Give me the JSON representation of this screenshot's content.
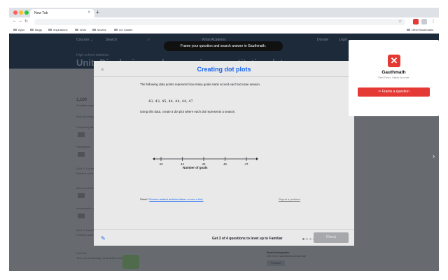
{
  "browser": {
    "tab_title": "New Tab",
    "tab_close": "×",
    "new_tab": "+",
    "bookmarks": [
      "Apps",
      "Blogs",
      "Inspirations",
      "Work",
      "Movies",
      "UX Guides"
    ],
    "other_bookmarks": "Other Bookmarks",
    "colors": {
      "close": "#ff5f57",
      "minimize": "#febc2e",
      "maximize": "#28c840"
    }
  },
  "background_page": {
    "nav": {
      "courses": "Courses ⌄",
      "search": "Search",
      "site": "Khan Academy",
      "donate": "Donate",
      "login": "Login"
    },
    "breadcrumb": "High school statistics",
    "title": "Unit: Displaying and comparing quantitative data",
    "side_items": [
      "1,100",
      "Possible mastery points",
      "Skill Summary",
      "Frequency tables & dot plots",
      "Histograms",
      "Quiz 1: 5 questions",
      "Practice what you've learned, and level up on the above skills",
      "Mean and median",
      "Interquartile range (IQR)",
      "Quiz 2: 5 questions",
      "Practice what you've learned, and level up on the above skills",
      "Unit test",
      "Test your knowledge of all skills in this unit"
    ],
    "card": {
      "title": "Read histograms",
      "subtitle": "Get 3 of 4 questions to level up!",
      "button": "Practice"
    }
  },
  "banner": "Frame your question and search answer in Gauthmath.",
  "modal": {
    "close": "×",
    "title": "Creating dot plots",
    "intro": "The following data points represent how many goals Hank scored each lacrosse season.",
    "data_values": "43, 43, 45, 44, 44, 44, 47",
    "instruction": "Using this data, create a dot plot where each dot represents a season.",
    "axis": {
      "ticks": [
        "43",
        "44",
        "45",
        "46",
        "47"
      ],
      "label": "Number of goals"
    },
    "stuck_prefix": "Stuck?",
    "stuck_link": "Review related articles/videos or use a hint.",
    "report": "Report a problem",
    "progress": "Get 3 of 4 questions to level up to Familiar",
    "check": "Check"
  },
  "gauthmath": {
    "logo": "✕",
    "name": "Gauthmath",
    "tagline": "Real Tutors, Highly Accurate",
    "button": "✂ Frame a question",
    "accent": "#e53935"
  },
  "pager": "›"
}
